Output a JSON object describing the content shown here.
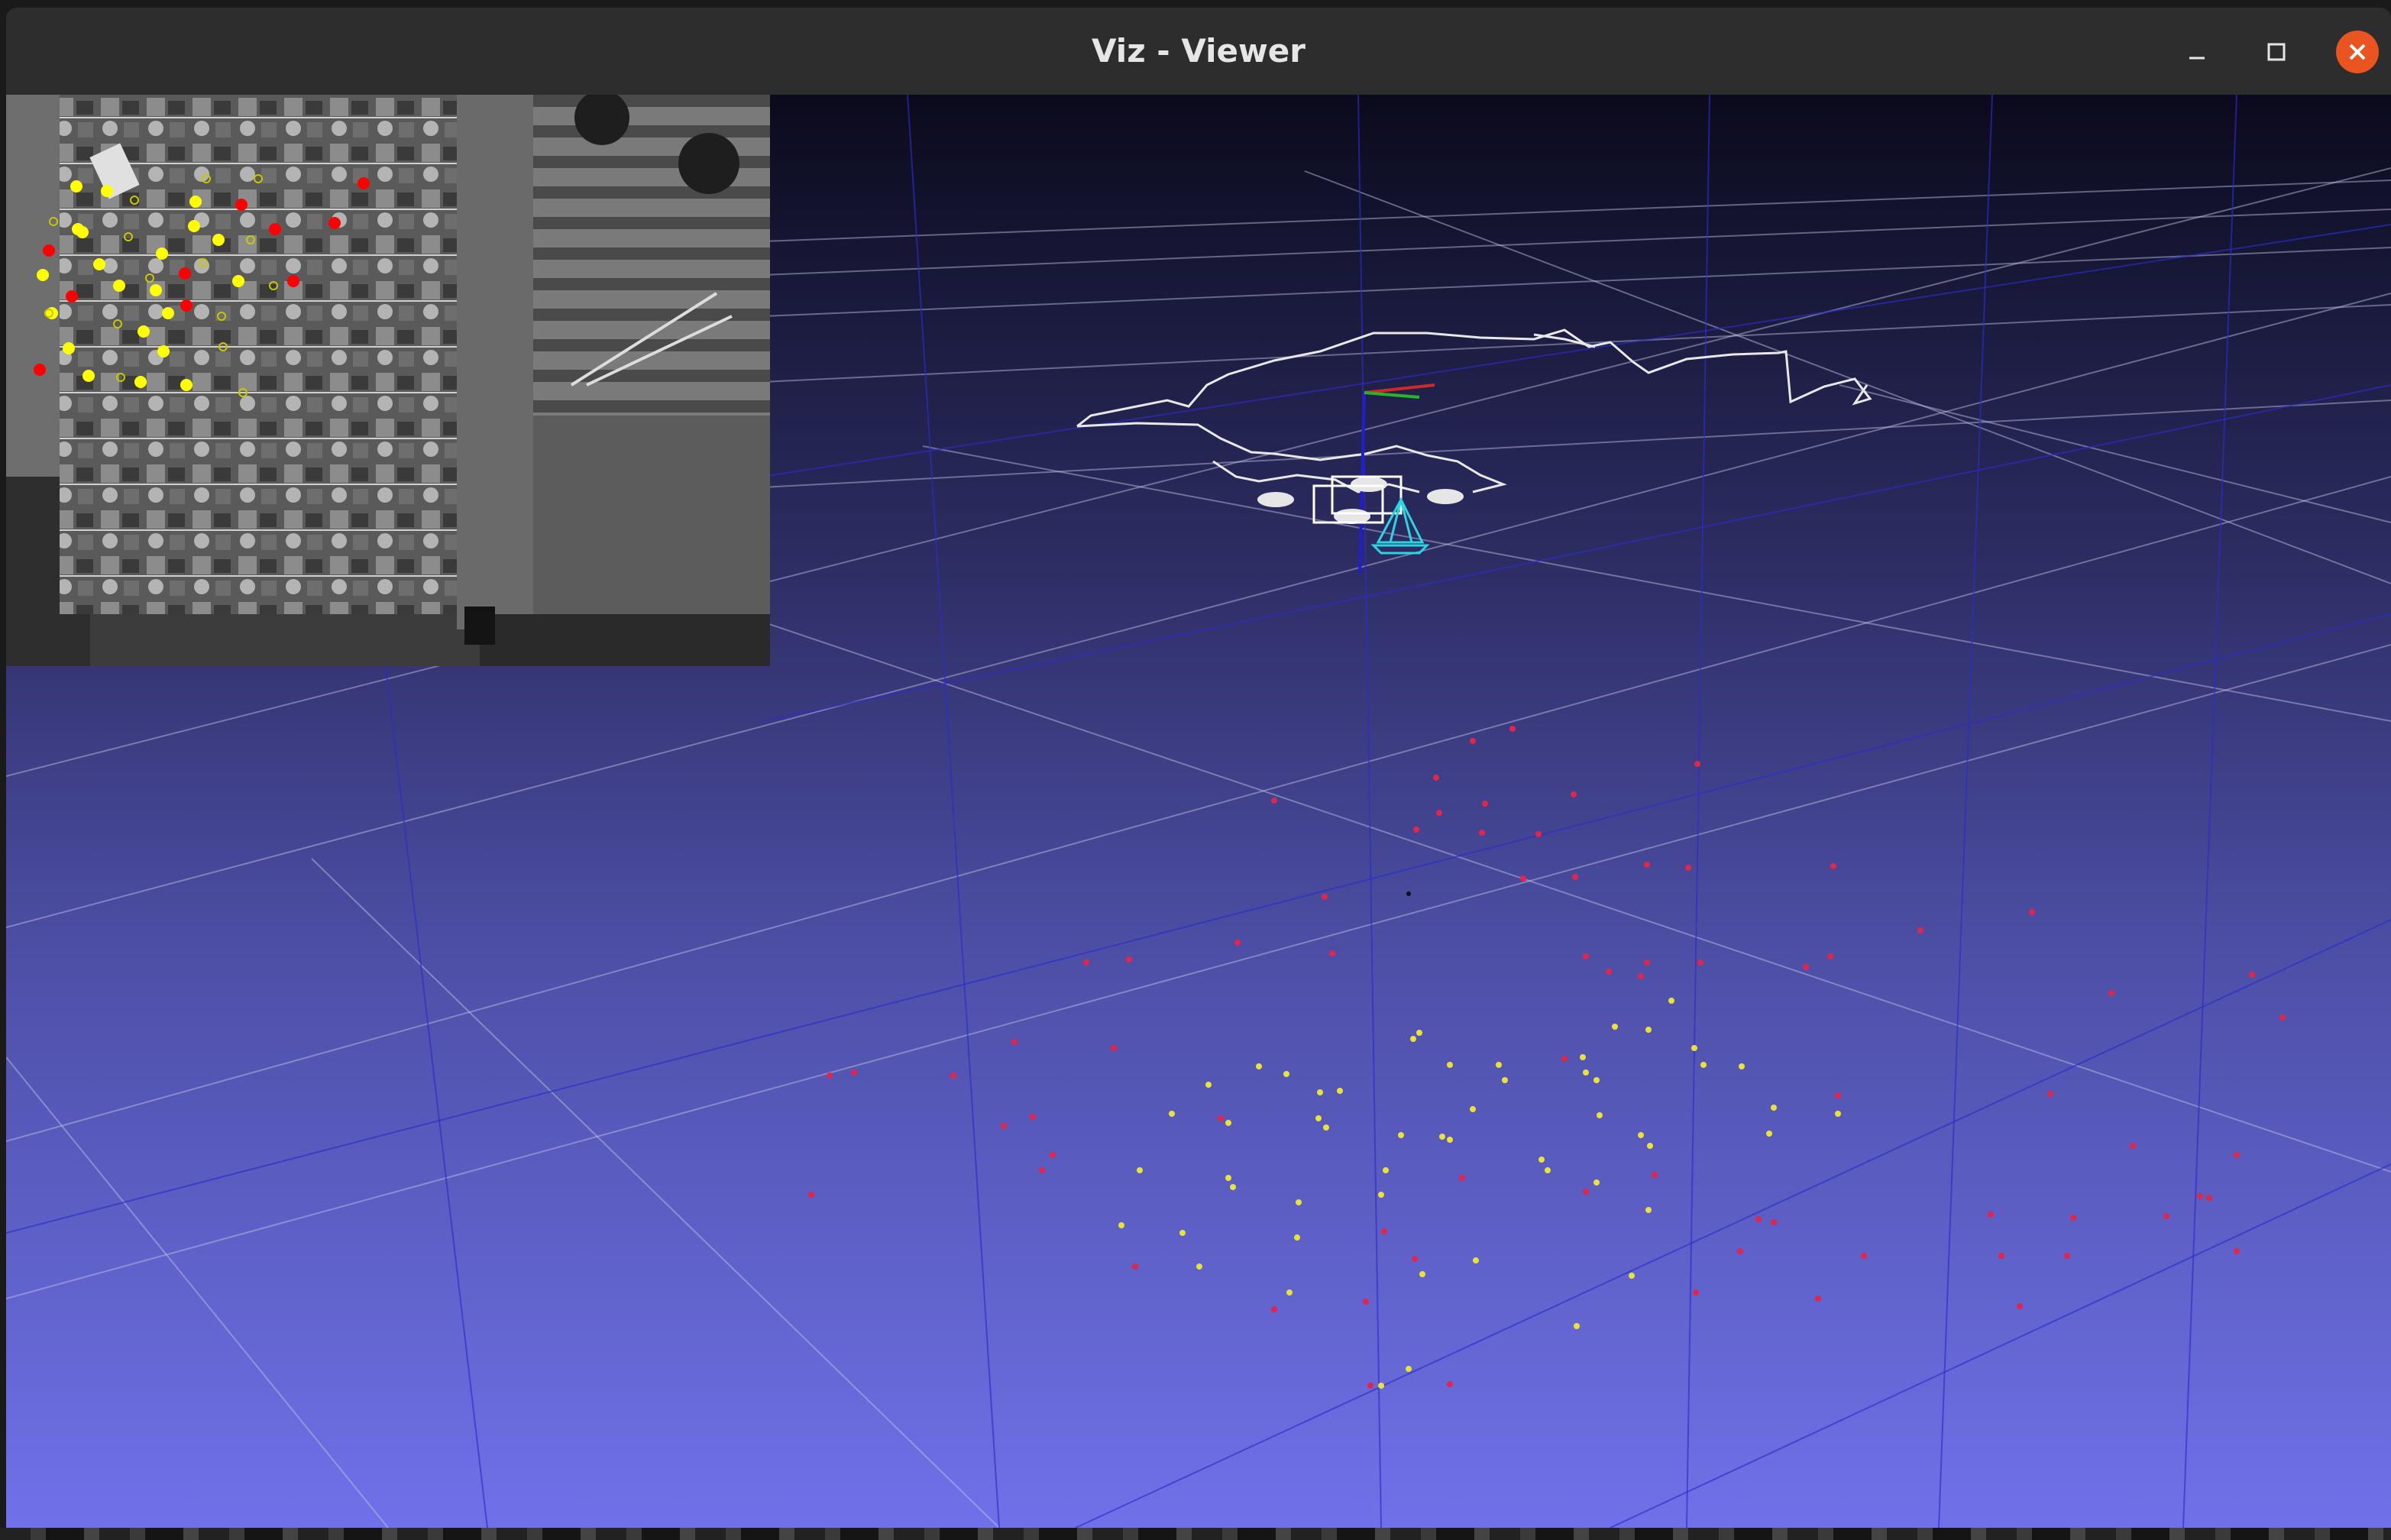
{
  "window": {
    "title": "Viz - Viewer",
    "controls": {
      "minimize_icon": "minimize-icon",
      "maximize_icon": "maximize-icon",
      "close_icon": "close-icon"
    },
    "close_color": "#e95420"
  },
  "viewer": {
    "background_top": "#0b0a1c",
    "background_bottom": "#7071e9",
    "grid_color_white": "#c8c8e6",
    "grid_color_blue": "#2d2dc8",
    "trajectory_color": "#e8e8e8",
    "map_points": {
      "triangulated_color": "#e8e23a",
      "tracked_color": "#e0264a"
    },
    "camera_frustum_color": "#2ad4e0"
  },
  "camera_image": {
    "features": {
      "tracked_color": "#ff0000",
      "matched_color": "#ffff00",
      "candidate_color": "#c8c800"
    }
  }
}
